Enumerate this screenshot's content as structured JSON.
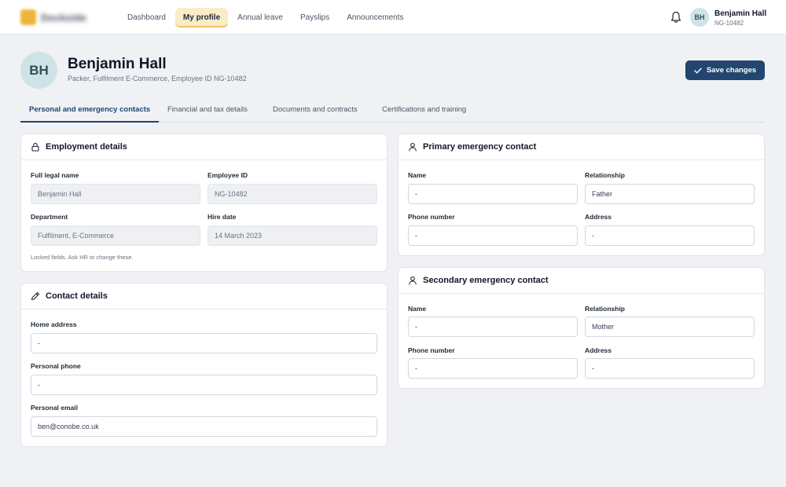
{
  "nav": {
    "brand": "Dockside",
    "items": [
      {
        "label": "Dashboard",
        "active": false
      },
      {
        "label": "My profile",
        "active": true
      },
      {
        "label": "Annual leave",
        "active": false
      },
      {
        "label": "Payslips",
        "active": false
      },
      {
        "label": "Announcements",
        "active": false
      }
    ],
    "user": {
      "initials": "BH",
      "name": "Benjamin Hall",
      "id": "NG-10482"
    }
  },
  "header": {
    "initials": "BH",
    "name": "Benjamin Hall",
    "subtitle": "Packer, Fulfilment E-Commerce, Employee ID NG-10482",
    "save_label": "Save changes"
  },
  "tabs": [
    {
      "label": "Personal and emergency contacts",
      "active": true
    },
    {
      "label": "Financial and tax details",
      "active": false
    },
    {
      "label": "Documents and contracts",
      "active": false
    },
    {
      "label": "Certifications and training",
      "active": false
    }
  ],
  "employment": {
    "title": "Employment details",
    "full_name_label": "Full legal name",
    "full_name": "Benjamin Hall",
    "employee_id_label": "Employee ID",
    "employee_id": "NG-10482",
    "department_label": "Department",
    "department": "Fulfilment, E-Commerce",
    "hire_date_label": "Hire date",
    "hire_date": "14 March 2023",
    "note": "Locked fields. Ask HR to change these."
  },
  "contact": {
    "title": "Contact details",
    "home_address_label": "Home address",
    "home_address": "-",
    "phone_label": "Personal phone",
    "phone": "-",
    "email_label": "Personal email",
    "email": "ben@conobe.co.uk"
  },
  "primary": {
    "title": "Primary emergency contact",
    "name_label": "Name",
    "name": "-",
    "relationship_label": "Relationship",
    "relationship": "Father",
    "phone_label": "Phone number",
    "phone": "-",
    "address_label": "Address",
    "address": "-"
  },
  "secondary": {
    "title": "Secondary emergency contact",
    "name_label": "Name",
    "name": "-",
    "relationship_label": "Relationship",
    "relationship": "Mother",
    "phone_label": "Phone number",
    "phone": "-",
    "address_label": "Address",
    "address": "-"
  },
  "icons": {
    "bell": "bell-icon",
    "lock": "lock-icon",
    "pencil": "pencil-icon",
    "person": "person-icon",
    "check": "check-icon"
  },
  "colors": {
    "primary": "#22466f",
    "active_nav": "#fbecc8",
    "avatar_bg": "#cfe3e6",
    "page_bg": "#eff1f5"
  }
}
